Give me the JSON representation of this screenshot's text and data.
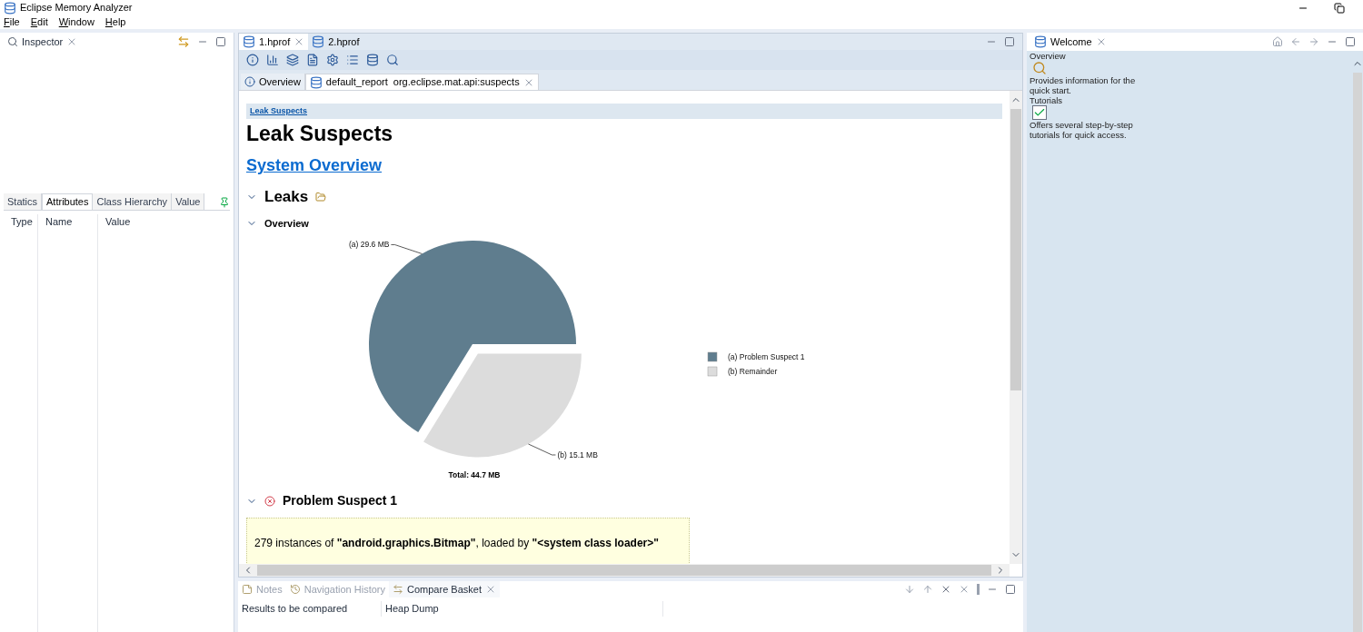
{
  "window": {
    "title": "Eclipse Memory Analyzer"
  },
  "menu": [
    "File",
    "Edit",
    "Window",
    "Help"
  ],
  "inspector": {
    "title": "Inspector",
    "tabs": [
      {
        "label": "Statics",
        "selected": false
      },
      {
        "label": "Attributes",
        "selected": true
      },
      {
        "label": "Class Hierarchy",
        "selected": false
      },
      {
        "label": "Value",
        "selected": false
      }
    ],
    "columns": [
      "Type",
      "Name",
      "Value"
    ]
  },
  "editor": {
    "tabs": [
      {
        "label": "1.hprof",
        "selected": true
      },
      {
        "label": "2.hprof",
        "selected": false
      }
    ],
    "subtabs": [
      {
        "label": "Overview",
        "selected": false
      },
      {
        "label": "default_report  org.eclipse.mat.api:suspects",
        "selected": true
      }
    ],
    "report": {
      "breadcrumb": "Leak Suspects",
      "heading": "Leak Suspects",
      "link": "System Overview",
      "section": "Leaks",
      "subsection": "Overview",
      "chart_data": {
        "type": "pie",
        "title": "Total: 44.7 MB",
        "categories": [
          "(a)  Problem Suspect 1",
          "(b)  Remainder"
        ],
        "values": [
          29.6,
          15.1
        ],
        "colors": [
          "#5f7d8e",
          "#dcdcdc"
        ],
        "legend": "right",
        "value_labels": [
          "(a)  29.6 MB",
          "(b)  15.1 MB"
        ]
      },
      "suspect": {
        "title": "Problem Suspect 1",
        "description": "279 instances of **\"android.graphics.Bitmap\"**, loaded by **\"<system class loader>\"**"
      }
    }
  },
  "welcome": {
    "title": "Welcome",
    "items": [
      {
        "title": "Overview",
        "description": "Provides information for the quick start."
      },
      {
        "title": "Tutorials",
        "description": "Offers several step-by-step tutorials for quick access."
      }
    ]
  },
  "bottom": {
    "tabs": [
      {
        "label": "Notes",
        "selected": false
      },
      {
        "label": "Navigation History",
        "selected": false
      },
      {
        "label": "Compare Basket",
        "selected": true
      }
    ],
    "columns": [
      "Results to be compared",
      "Heap Dump"
    ]
  }
}
